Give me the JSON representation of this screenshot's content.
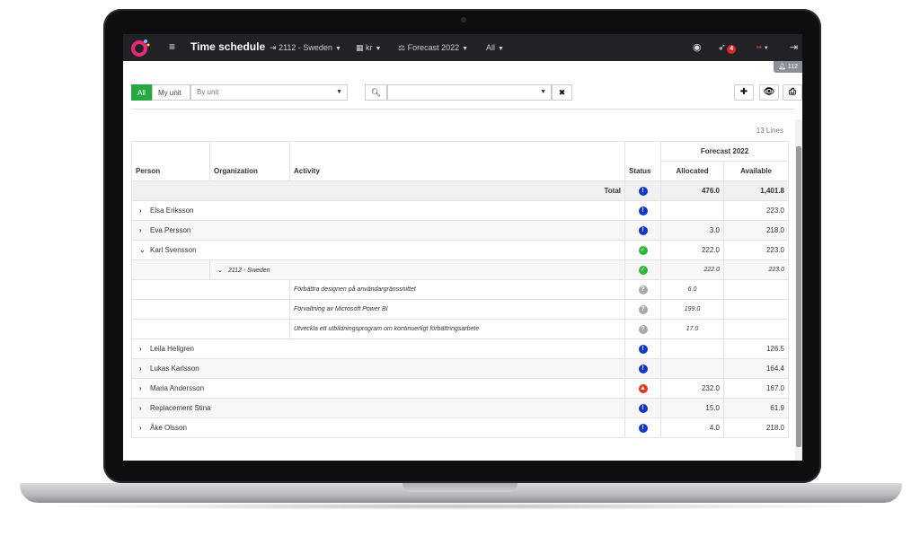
{
  "app": {
    "title": "Time schedule",
    "nav": {
      "unit": "2112 - Sweden",
      "currency": "kr",
      "forecast": "Forecast 2022",
      "scope": "All"
    },
    "notifications_count": "4",
    "bell_count": "112"
  },
  "filters": {
    "all_label": "All",
    "my_unit_label": "My unit",
    "by_unit_placeholder": "By unit",
    "search_value": ""
  },
  "summary": {
    "lines": "13 Lines"
  },
  "table": {
    "group_header": "Forecast 2022",
    "headers": {
      "person": "Person",
      "organization": "Organization",
      "activity": "Activity",
      "status": "Status",
      "allocated": "Allocated",
      "available": "Available"
    },
    "total": {
      "label": "Total",
      "status": "blue",
      "allocated": "476.0",
      "available": "1,401.8"
    },
    "rows": [
      {
        "name": "Elsa Eriksson",
        "status": "blue",
        "allocated": "",
        "available": "223.0",
        "expanded": false
      },
      {
        "name": "Eva Persson",
        "status": "blue",
        "allocated": "3.0",
        "available": "218.0",
        "expanded": false
      },
      {
        "name": "Karl Svensson",
        "status": "green",
        "allocated": "222.0",
        "available": "223.0",
        "expanded": true
      }
    ],
    "sub_org": {
      "name": "2112 - Sweden",
      "status": "green",
      "allocated": "222.0",
      "available": "223.0"
    },
    "activities": [
      {
        "name": "Förbättra designen på användargränssnittet",
        "status": "grey",
        "allocated": "6.0"
      },
      {
        "name": "Förvaltning av Microsoft Power BI",
        "status": "grey",
        "allocated": "199.0"
      },
      {
        "name": "Utveckla ett utbildningsprogram om kontinuerligt förbättringsarbete",
        "status": "grey",
        "allocated": "17.0"
      }
    ],
    "rows_after": [
      {
        "name": "Leila Hellgren",
        "status": "blue",
        "allocated": "",
        "available": "126.5"
      },
      {
        "name": "Lukas Karlsson",
        "status": "blue",
        "allocated": "",
        "available": "164.4"
      },
      {
        "name": "Maria Andersson",
        "status": "red",
        "allocated": "232.0",
        "available": "167.0"
      },
      {
        "name": "Replacement Stina",
        "status": "blue",
        "allocated": "15.0",
        "available": "61.9"
      },
      {
        "name": "Åke Olsson",
        "status": "blue",
        "allocated": "4.0",
        "available": "218.0"
      }
    ]
  }
}
